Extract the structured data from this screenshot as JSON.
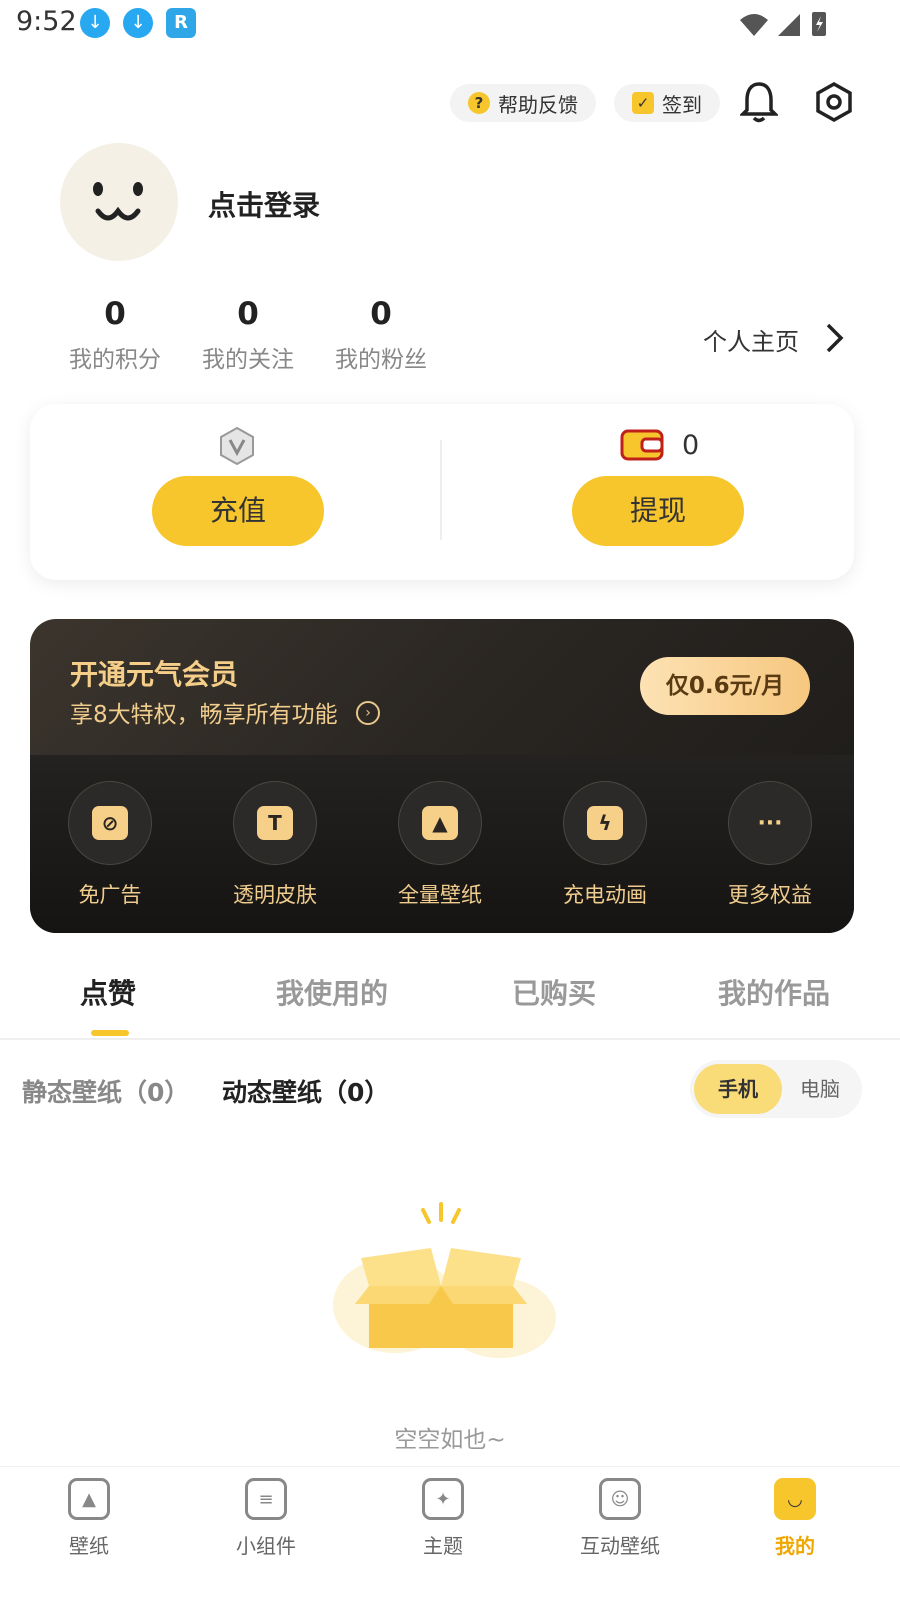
{
  "status_bar": {
    "time": "9:52"
  },
  "header": {
    "help_label": "帮助反馈",
    "checkin_label": "签到"
  },
  "profile": {
    "login_label": "点击登录",
    "homepage_label": "个人主页"
  },
  "stats": [
    {
      "value": "0",
      "label": "我的积分"
    },
    {
      "value": "0",
      "label": "我的关注"
    },
    {
      "value": "0",
      "label": "我的粉丝"
    }
  ],
  "wallet": {
    "recharge_label": "充值",
    "withdraw_label": "提现",
    "balance": "0"
  },
  "vip": {
    "title": "开通元气会员",
    "subtitle": "享8大特权，畅享所有功能",
    "price": "仅0.6元/月",
    "perks": [
      {
        "label": "免广告",
        "icon": "no-ads-icon"
      },
      {
        "label": "透明皮肤",
        "icon": "shirt-icon"
      },
      {
        "label": "全量壁纸",
        "icon": "image-icon"
      },
      {
        "label": "充电动画",
        "icon": "battery-icon"
      },
      {
        "label": "更多权益",
        "icon": "more-icon"
      }
    ]
  },
  "tabs": [
    "点赞",
    "我使用的",
    "已购买",
    "我的作品"
  ],
  "sub_tabs": [
    "静态壁纸（0）",
    "动态壁纸（0）"
  ],
  "device_toggle": {
    "phone": "手机",
    "pc": "电脑"
  },
  "empty_state": {
    "text": "空空如也~"
  },
  "bottom_nav": [
    {
      "label": "壁纸",
      "icon": "wallpaper-icon"
    },
    {
      "label": "小组件",
      "icon": "widget-icon"
    },
    {
      "label": "主题",
      "icon": "theme-icon"
    },
    {
      "label": "互动壁纸",
      "icon": "interactive-wallpaper-icon"
    },
    {
      "label": "我的",
      "icon": "me-icon"
    }
  ],
  "colors": {
    "accent": "#f7c62c",
    "vip_gold": "#f5cf89",
    "vip_bg": "#1c1a18"
  }
}
